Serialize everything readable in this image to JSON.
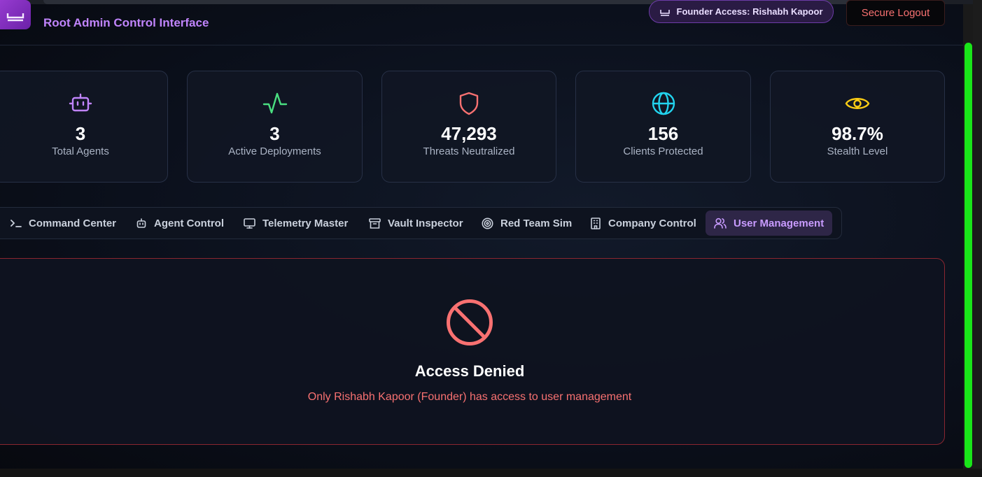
{
  "header": {
    "subtitle": "Root Admin Control Interface",
    "founder_badge": "Founder Access: Rishabh Kapoor",
    "logout_label": "Secure Logout"
  },
  "stats": [
    {
      "value": "3",
      "label": "Total Agents",
      "icon": "bot-icon",
      "color": "#c084fc"
    },
    {
      "value": "3",
      "label": "Active Deployments",
      "icon": "activity-icon",
      "color": "#4ade80"
    },
    {
      "value": "47,293",
      "label": "Threats Neutralized",
      "icon": "shield-icon",
      "color": "#f87171"
    },
    {
      "value": "156",
      "label": "Clients Protected",
      "icon": "globe-icon",
      "color": "#22d3ee"
    },
    {
      "value": "98.7%",
      "label": "Stealth Level",
      "icon": "eye-icon",
      "color": "#facc15"
    }
  ],
  "tabs": [
    {
      "label": "Command Center",
      "icon": "terminal-icon"
    },
    {
      "label": "Agent Control",
      "icon": "bot-icon"
    },
    {
      "label": "Telemetry Master",
      "icon": "monitor-icon"
    },
    {
      "label": "Vault Inspector",
      "icon": "archive-icon"
    },
    {
      "label": "Red Team Sim",
      "icon": "target-icon"
    },
    {
      "label": "Company Control",
      "icon": "building-icon"
    },
    {
      "label": "User Management",
      "icon": "users-icon",
      "active": true
    }
  ],
  "denied": {
    "title": "Access Denied",
    "message": "Only Rishabh Kapoor (Founder) has access to user management"
  },
  "colors": {
    "accent": "#c084fc",
    "danger": "#f87171",
    "scrollbar": "#19e619"
  }
}
